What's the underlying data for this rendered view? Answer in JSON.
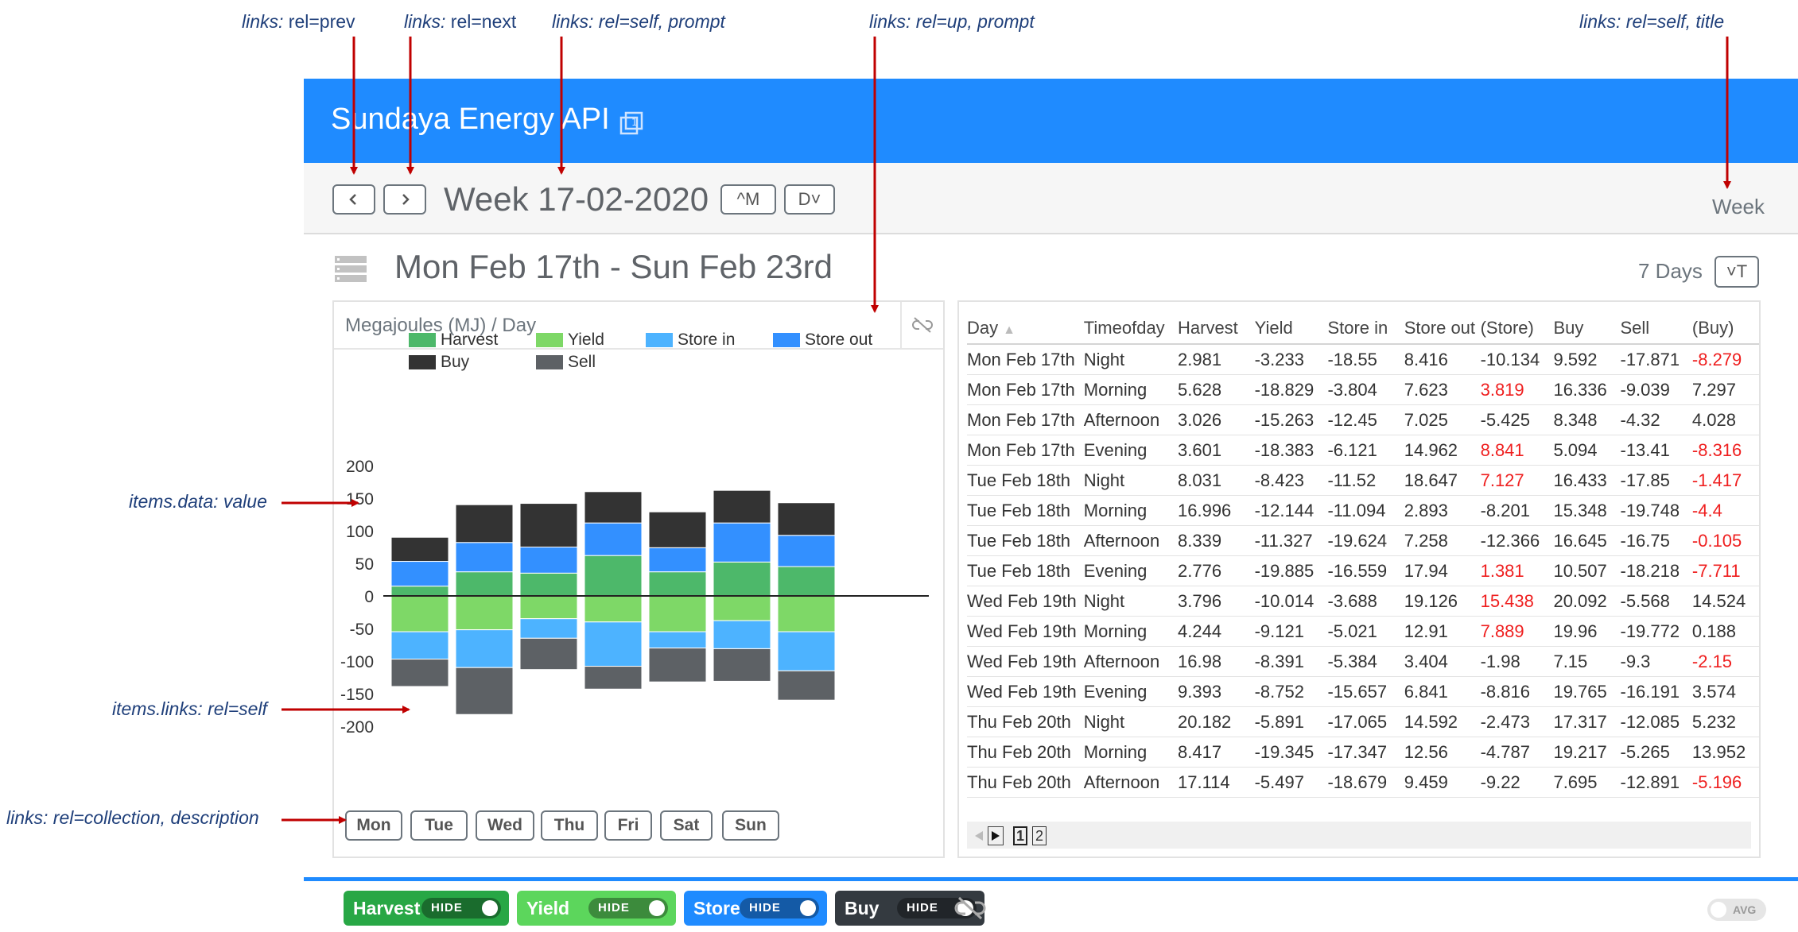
{
  "annotations": [
    {
      "id": "prev",
      "prefix": "links: ",
      "plain": "rel",
      "rest": "=prev"
    },
    {
      "id": "next",
      "prefix": "links: ",
      "plain": "rel",
      "rest": "=next"
    },
    {
      "id": "self_prompt",
      "prefix": "links: ",
      "plain": "",
      "rest": "rel=self, prompt"
    },
    {
      "id": "up_prompt",
      "prefix": "links: ",
      "plain": "",
      "rest": "rel=up, prompt"
    },
    {
      "id": "self_title",
      "prefix": "links: ",
      "plain": "",
      "rest": "rel=self, title"
    },
    {
      "id": "data_value",
      "prefix": "",
      "plain": "",
      "rest": "items.data: value"
    },
    {
      "id": "items_links",
      "prefix": "",
      "plain": "",
      "rest": "items.links: rel=self"
    },
    {
      "id": "collection",
      "prefix": "links: ",
      "plain": "",
      "rest": "rel=collection, description"
    }
  ],
  "header": {
    "title": "Sundaya Energy API",
    "accent": "#1f8bff"
  },
  "nav": {
    "prev_icon": "chevron-left",
    "next_icon": "chevron-right",
    "title": "Week 17-02-2020",
    "up_label": "^M",
    "down_label": "D˅",
    "right_title": "Week"
  },
  "section": {
    "title": "Mon Feb 17th - Sun Feb 23rd",
    "days_label": "7 Days",
    "sort_label": "˅T"
  },
  "chart_card": {
    "unit_label": "Megajoules (MJ) / Day"
  },
  "chart_data": {
    "type": "bar",
    "stacked": true,
    "categories": [
      "Mon",
      "Tue",
      "Wed",
      "Thu",
      "Fri",
      "Sat",
      "Sun"
    ],
    "ylim": [
      -200,
      200
    ],
    "yticks": [
      200,
      150,
      100,
      50,
      0,
      -50,
      -100,
      -150,
      -200
    ],
    "legend_position": "top",
    "series": [
      {
        "name": "Harvest",
        "color": "#4db86a",
        "values": [
          15,
          37,
          35,
          62,
          37,
          52,
          45
        ]
      },
      {
        "name": "Yield",
        "color": "#7ed867",
        "values": [
          -55,
          -52,
          -35,
          -40,
          -55,
          -38,
          -55
        ]
      },
      {
        "name": "Store in",
        "color": "#4db3ff",
        "values": [
          -42,
          -58,
          -30,
          -68,
          -25,
          -43,
          -60
        ]
      },
      {
        "name": "Store out",
        "color": "#3390ff",
        "values": [
          38,
          45,
          40,
          50,
          37,
          60,
          48
        ]
      },
      {
        "name": "Buy",
        "color": "#333333",
        "values": [
          37,
          58,
          67,
          48,
          55,
          50,
          50
        ]
      },
      {
        "name": "Sell",
        "color": "#5d6165",
        "values": [
          -42,
          -72,
          -48,
          -35,
          -52,
          -50,
          -45
        ]
      }
    ]
  },
  "table": {
    "columns": [
      "Day",
      "Timeofday",
      "Harvest",
      "Yield",
      "Store in",
      "Store out",
      "(Store)",
      "Buy",
      "Sell",
      "(Buy)"
    ],
    "sort_indicator": "▲",
    "rows": [
      [
        "Mon Feb 17th",
        "Night",
        "2.981",
        "-3.233",
        "-18.55",
        "8.416",
        "-10.134",
        "9.592",
        "-17.871",
        "-8.279"
      ],
      [
        "Mon Feb 17th",
        "Morning",
        "5.628",
        "-18.829",
        "-3.804",
        "7.623",
        "3.819",
        "16.336",
        "-9.039",
        "7.297"
      ],
      [
        "Mon Feb 17th",
        "Afternoon",
        "3.026",
        "-15.263",
        "-12.45",
        "7.025",
        "-5.425",
        "8.348",
        "-4.32",
        "4.028"
      ],
      [
        "Mon Feb 17th",
        "Evening",
        "3.601",
        "-18.383",
        "-6.121",
        "14.962",
        "8.841",
        "5.094",
        "-13.41",
        "-8.316"
      ],
      [
        "Tue Feb 18th",
        "Night",
        "8.031",
        "-8.423",
        "-11.52",
        "18.647",
        "7.127",
        "16.433",
        "-17.85",
        "-1.417"
      ],
      [
        "Tue Feb 18th",
        "Morning",
        "16.996",
        "-12.144",
        "-11.094",
        "2.893",
        "-8.201",
        "15.348",
        "-19.748",
        "-4.4"
      ],
      [
        "Tue Feb 18th",
        "Afternoon",
        "8.339",
        "-11.327",
        "-19.624",
        "7.258",
        "-12.366",
        "16.645",
        "-16.75",
        "-0.105"
      ],
      [
        "Tue Feb 18th",
        "Evening",
        "2.776",
        "-19.885",
        "-16.559",
        "17.94",
        "1.381",
        "10.507",
        "-18.218",
        "-7.711"
      ],
      [
        "Wed Feb 19th",
        "Night",
        "3.796",
        "-10.014",
        "-3.688",
        "19.126",
        "15.438",
        "20.092",
        "-5.568",
        "14.524"
      ],
      [
        "Wed Feb 19th",
        "Morning",
        "4.244",
        "-9.121",
        "-5.021",
        "12.91",
        "7.889",
        "19.96",
        "-19.772",
        "0.188"
      ],
      [
        "Wed Feb 19th",
        "Afternoon",
        "16.98",
        "-8.391",
        "-5.384",
        "3.404",
        "-1.98",
        "7.15",
        "-9.3",
        "-2.15"
      ],
      [
        "Wed Feb 19th",
        "Evening",
        "9.393",
        "-8.752",
        "-15.657",
        "6.841",
        "-8.816",
        "19.765",
        "-16.191",
        "3.574"
      ],
      [
        "Thu Feb 20th",
        "Night",
        "20.182",
        "-5.891",
        "-17.065",
        "14.592",
        "-2.473",
        "17.317",
        "-12.085",
        "5.232"
      ],
      [
        "Thu Feb 20th",
        "Morning",
        "8.417",
        "-19.345",
        "-17.347",
        "12.56",
        "-4.787",
        "19.217",
        "-5.265",
        "13.952"
      ],
      [
        "Thu Feb 20th",
        "Afternoon",
        "17.114",
        "-5.497",
        "-18.679",
        "9.459",
        "-9.22",
        "7.695",
        "-12.891",
        "-5.196"
      ]
    ],
    "red_cells": [
      [
        0,
        9
      ],
      [
        1,
        6
      ],
      [
        3,
        6
      ],
      [
        3,
        9
      ],
      [
        4,
        6
      ],
      [
        4,
        9
      ],
      [
        5,
        9
      ],
      [
        6,
        9
      ],
      [
        7,
        6
      ],
      [
        7,
        9
      ],
      [
        8,
        6
      ],
      [
        9,
        6
      ],
      [
        10,
        9
      ],
      [
        14,
        9
      ]
    ],
    "pages": [
      "1",
      "2"
    ]
  },
  "footer": {
    "toggles": [
      {
        "label": "Harvest",
        "state": "HIDE",
        "color": "#28a745"
      },
      {
        "label": "Yield",
        "state": "HIDE",
        "color": "#5cd65c"
      },
      {
        "label": "Store",
        "state": "HIDE",
        "color": "#1f8bff"
      },
      {
        "label": "Buy",
        "state": "HIDE",
        "color": "#343a40"
      }
    ],
    "avg_label": "AVG"
  }
}
